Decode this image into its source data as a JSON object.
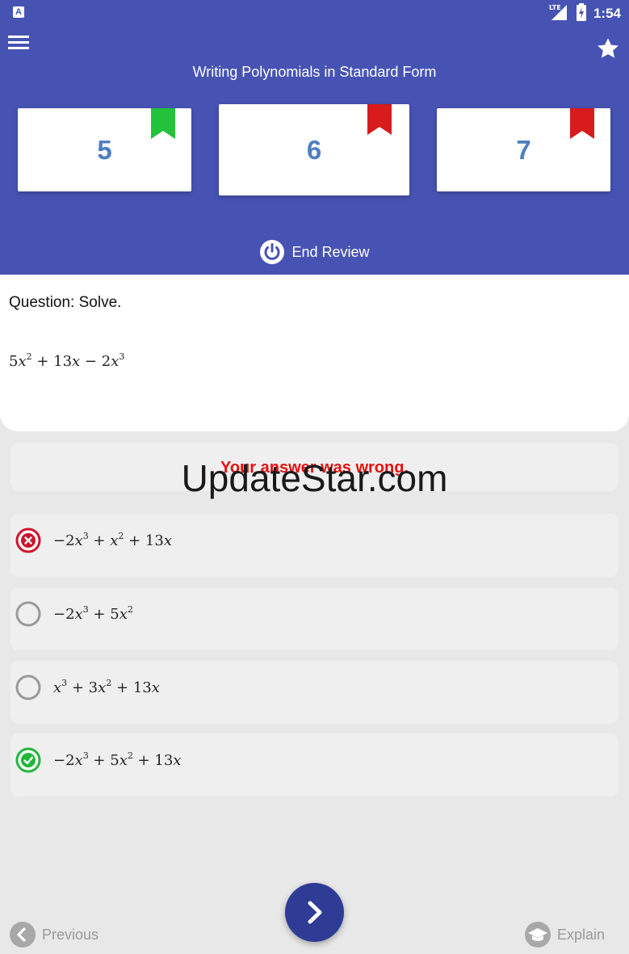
{
  "status_bar": {
    "time": "1:54",
    "app_letter": "A",
    "network": "LTE"
  },
  "header": {
    "title": "Writing Polynomials in Standard Form",
    "cards": [
      {
        "number": "5",
        "bookmark_color": "#22c23a"
      },
      {
        "number": "6",
        "bookmark_color": "#d81b1b"
      },
      {
        "number": "7",
        "bookmark_color": "#d81b1b"
      }
    ],
    "end_review_label": "End Review"
  },
  "question": {
    "label": "Question: Solve.",
    "expression": "5x^2 + 13x − 2x^3"
  },
  "feedback": {
    "text": "Your answer was wrong."
  },
  "watermark": {
    "text": "UpdateStar.com"
  },
  "options": [
    {
      "text": "−2x^3 + x^2 + 13x",
      "state": "wrong"
    },
    {
      "text": "−2x^3 + 5x^2",
      "state": "unselected"
    },
    {
      "text": "x^3 + 3x^2 + 13x",
      "state": "unselected"
    },
    {
      "text": "−2x^3 + 5x^2 + 13x",
      "state": "correct"
    }
  ],
  "bottom": {
    "previous_label": "Previous",
    "explain_label": "Explain"
  },
  "colors": {
    "header": "#4753b3",
    "wrong": "#d0142c",
    "correct": "#22b83a",
    "accent": "#2f3c95"
  }
}
